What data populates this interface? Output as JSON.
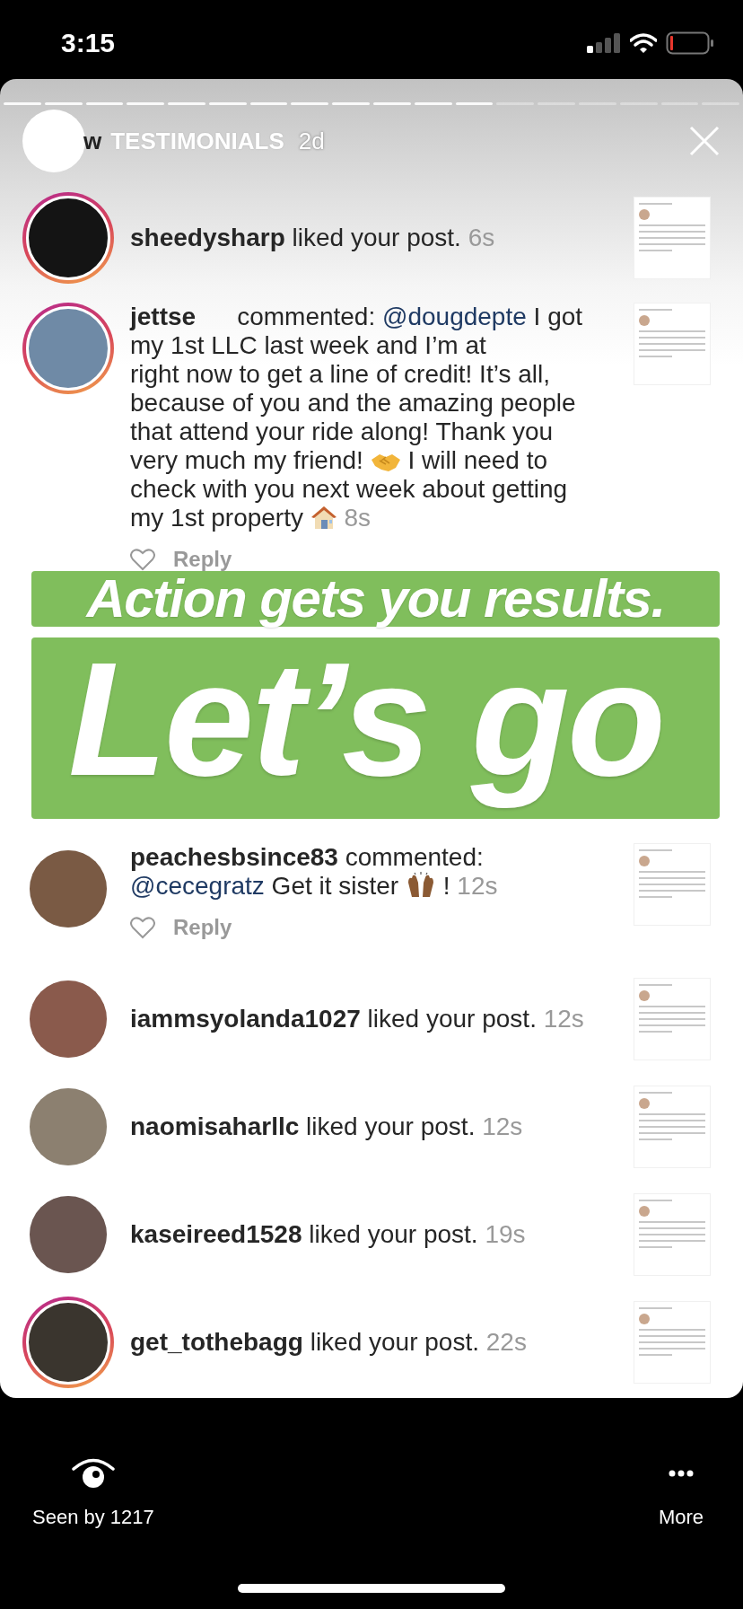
{
  "status_bar": {
    "time": "3:15"
  },
  "story": {
    "progress": [
      {
        "seen": true
      },
      {
        "seen": true
      },
      {
        "seen": true
      },
      {
        "seen": true
      },
      {
        "seen": true
      },
      {
        "seen": true
      },
      {
        "seen": true
      },
      {
        "seen": true
      },
      {
        "seen": true
      },
      {
        "seen": true
      },
      {
        "seen": true
      },
      {
        "seen": true
      },
      {
        "seen": false
      },
      {
        "seen": false
      },
      {
        "seen": false
      },
      {
        "seen": false
      },
      {
        "seen": false
      },
      {
        "seen": false
      }
    ],
    "author_fragment": "w",
    "title": "TESTIMONIALS",
    "age": "2d"
  },
  "notifications": [
    {
      "kind": "like",
      "story_ring": true,
      "segments": [
        {
          "kind": "user",
          "text": "sheedysharp"
        },
        {
          "kind": "text",
          "text": "liked your post."
        },
        {
          "kind": "time",
          "text": "6s"
        }
      ]
    },
    {
      "kind": "comment",
      "story_ring": true,
      "reply": "Reply",
      "segments": [
        {
          "kind": "user",
          "text": "jettse"
        },
        {
          "kind": "gap"
        },
        {
          "kind": "text",
          "text": "commented:"
        },
        {
          "kind": "mention",
          "text": "@dougdepte"
        },
        {
          "kind": "text",
          "text": "I got my 1st LLC last week and I’m at"
        },
        {
          "kind": "gap"
        },
        {
          "kind": "text",
          "text": "right now to get a line of credit! It’s all, because of you and the amazing people that attend your ride along! Thank you very much my friend!"
        },
        {
          "kind": "emoji"
        },
        {
          "kind": "text",
          "text": "I will need to check with you next week about getting my 1st property"
        },
        {
          "kind": "emoji"
        },
        {
          "kind": "time",
          "text": "8s"
        }
      ]
    },
    {
      "kind": "comment",
      "story_ring": false,
      "reply": "Reply",
      "segments": [
        {
          "kind": "user",
          "text": "peachesbsince83"
        },
        {
          "kind": "text",
          "text": "commented:"
        },
        {
          "kind": "mention",
          "text": "@cecegratz"
        },
        {
          "kind": "text",
          "text": "Get it sister"
        },
        {
          "kind": "emoji"
        },
        {
          "kind": "text",
          "text": "!"
        },
        {
          "kind": "time",
          "text": "12s"
        }
      ]
    },
    {
      "kind": "like",
      "story_ring": false,
      "segments": [
        {
          "kind": "user",
          "text": "iammsyolanda1027"
        },
        {
          "kind": "text",
          "text": "liked your post."
        },
        {
          "kind": "time",
          "text": "12s"
        }
      ]
    },
    {
      "kind": "like",
      "story_ring": false,
      "segments": [
        {
          "kind": "user",
          "text": "naomisaharllc"
        },
        {
          "kind": "text",
          "text": "liked your post."
        },
        {
          "kind": "time",
          "text": "12s"
        }
      ]
    },
    {
      "kind": "like",
      "story_ring": false,
      "segments": [
        {
          "kind": "user",
          "text": "kaseireed1528"
        },
        {
          "kind": "text",
          "text": "liked your post."
        },
        {
          "kind": "time",
          "text": "19s"
        }
      ]
    },
    {
      "kind": "like",
      "story_ring": true,
      "segments": [
        {
          "kind": "user",
          "text": "get_tothebagg"
        },
        {
          "kind": "text",
          "text": "liked your post."
        },
        {
          "kind": "time",
          "text": "22s"
        }
      ]
    }
  ],
  "overlay_captions": [
    "Action gets you results.",
    "Let’s go"
  ],
  "footer": {
    "seen": "Seen by 1217",
    "more": "More"
  }
}
